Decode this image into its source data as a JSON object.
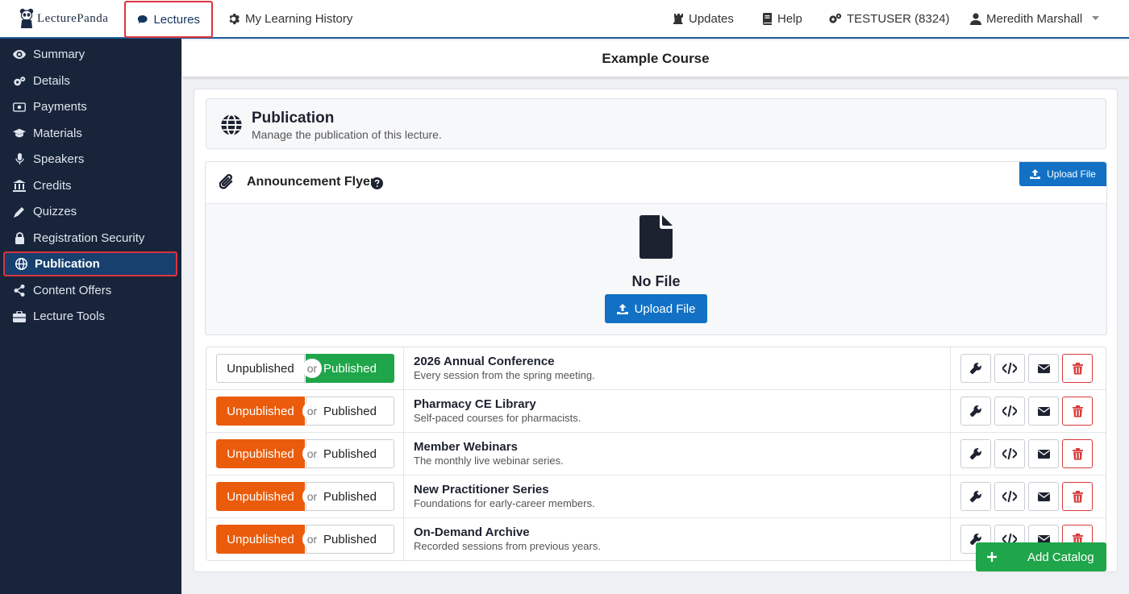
{
  "app": {
    "logo_text": "LecturePanda"
  },
  "topnav": {
    "tabs": [
      {
        "label": "Lectures",
        "icon": "comment-icon"
      },
      {
        "label": "My Learning History",
        "icon": "gear-icon"
      }
    ],
    "right": [
      {
        "label": "Updates",
        "icon": "chess-rook-icon"
      },
      {
        "label": "Help",
        "icon": "book-icon"
      },
      {
        "label": "TESTUSER (8324)",
        "icon": "cogs-icon"
      },
      {
        "label": "Meredith Marshall",
        "icon": "user-icon"
      }
    ]
  },
  "sidebar": {
    "items": [
      {
        "label": "Summary",
        "icon": "eye-icon"
      },
      {
        "label": "Details",
        "icon": "cogs-icon"
      },
      {
        "label": "Payments",
        "icon": "money-icon"
      },
      {
        "label": "Materials",
        "icon": "graduation-cap-icon"
      },
      {
        "label": "Speakers",
        "icon": "microphone-icon"
      },
      {
        "label": "Credits",
        "icon": "institution-icon"
      },
      {
        "label": "Quizzes",
        "icon": "pencil-icon"
      },
      {
        "label": "Registration Security",
        "icon": "lock-icon"
      },
      {
        "label": "Publication",
        "icon": "globe-icon",
        "active": true
      },
      {
        "label": "Content Offers",
        "icon": "share-icon"
      },
      {
        "label": "Lecture Tools",
        "icon": "toolbox-icon"
      }
    ]
  },
  "page": {
    "course_title": "Example Course"
  },
  "publication": {
    "title": "Publication",
    "subtitle": "Manage the publication of this lecture."
  },
  "flyer": {
    "title": "Announcement Flyer",
    "upload_small": "Upload File",
    "no_file": "No File",
    "upload_main": "Upload File"
  },
  "toggle": {
    "unpublished": "Unpublished",
    "or": "or",
    "published": "Published"
  },
  "catalogs": [
    {
      "name": "2026 Annual Conference",
      "desc": "Every session from the spring meeting.",
      "state": "published"
    },
    {
      "name": "Pharmacy CE Library",
      "desc": "Self-paced courses for pharmacists.",
      "state": "unpublished"
    },
    {
      "name": "Member Webinars",
      "desc": "The monthly live webinar series.",
      "state": "unpublished"
    },
    {
      "name": "New Practitioner Series",
      "desc": "Foundations for early-career members.",
      "state": "unpublished"
    },
    {
      "name": "On-Demand Archive",
      "desc": "Recorded sessions from previous years.",
      "state": "unpublished"
    }
  ],
  "add_catalog": {
    "label": "Add Catalog"
  },
  "colors": {
    "primary": "#1271c4",
    "published": "#1fa64a",
    "unpublished": "#ea5c0c",
    "sidebar": "#18243a",
    "danger": "#d93a3a"
  }
}
